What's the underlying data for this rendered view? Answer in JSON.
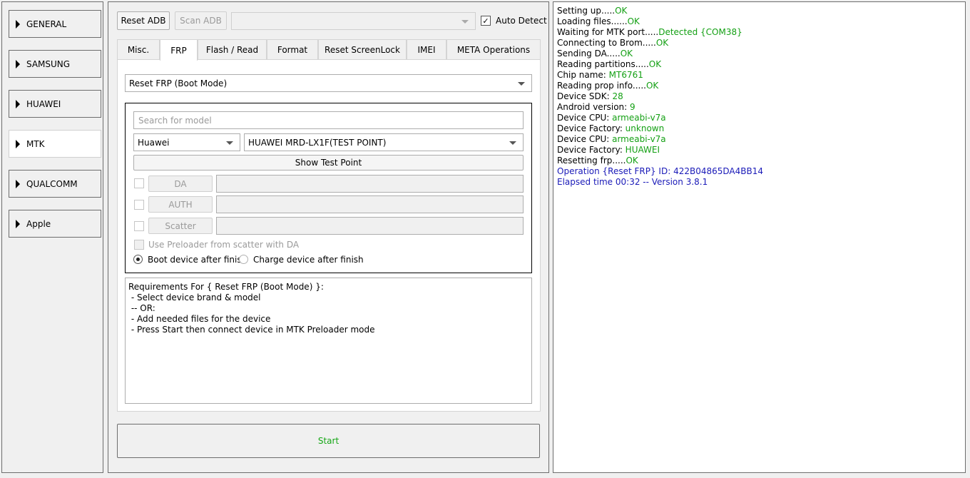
{
  "sidebar": {
    "items": [
      {
        "label": "GENERAL"
      },
      {
        "label": "SAMSUNG"
      },
      {
        "label": "HUAWEI"
      },
      {
        "label": "MTK"
      },
      {
        "label": "QUALCOMM"
      },
      {
        "label": "Apple"
      }
    ],
    "active": "MTK"
  },
  "toolbar": {
    "reset_adb": "Reset ADB",
    "scan_adb": "Scan ADB",
    "port_value": "",
    "auto_detect_label": "Auto Detect",
    "auto_detect_checked": "✓"
  },
  "tabs": [
    {
      "label": "Misc."
    },
    {
      "label": "FRP"
    },
    {
      "label": "Flash / Read"
    },
    {
      "label": "Format"
    },
    {
      "label": "Reset ScreenLock"
    },
    {
      "label": "IMEI"
    },
    {
      "label": "META Operations"
    }
  ],
  "frp": {
    "operation": "Reset FRP (Boot Mode)",
    "search_placeholder": "Search for model",
    "brand": "Huawei",
    "model": "HUAWEI MRD-LX1F(TEST POINT)",
    "show_test_point": "Show Test Point",
    "files": [
      {
        "label": "DA",
        "path": ""
      },
      {
        "label": "AUTH",
        "path": ""
      },
      {
        "label": "Scatter",
        "path": ""
      }
    ],
    "use_preloader": "Use Preloader from scatter with DA",
    "boot_after": "Boot device after finish",
    "charge_after": "Charge device after finish",
    "requirements": [
      "Requirements For { Reset FRP (Boot Mode) }:",
      " - Select device brand & model",
      " -- OR:",
      " - Add needed files for the device",
      " - Press Start then connect device in MTK Preloader mode"
    ]
  },
  "start_label": "Start",
  "log": [
    {
      "text": "Setting up.....",
      "value": "OK"
    },
    {
      "text": "Loading files......",
      "value": "OK"
    },
    {
      "text": "Waiting for MTK port.....",
      "value": "Detected {COM38}"
    },
    {
      "text": "Connecting to Brom.....",
      "value": "OK"
    },
    {
      "text": "Sending DA.....",
      "value": "OK"
    },
    {
      "text": "Reading partitions.....",
      "value": "OK"
    },
    {
      "text": "Chip name: ",
      "value": "MT6761"
    },
    {
      "text": "Reading prop info.....",
      "value": "OK"
    },
    {
      "text": "Device SDK: ",
      "value": "28"
    },
    {
      "text": "Android version: ",
      "value": "9"
    },
    {
      "text": "Device CPU: ",
      "value": "armeabi-v7a"
    },
    {
      "text": "Device Factory: ",
      "value": "unknown"
    },
    {
      "text": "Device CPU: ",
      "value": "armeabi-v7a"
    },
    {
      "text": "Device Factory: ",
      "value": "HUAWEI"
    },
    {
      "text": "Resetting frp.....",
      "value": "OK"
    },
    {
      "text": "Operation {Reset FRP} ID: 422B04865DA4BB14",
      "value": ""
    },
    {
      "text": "Elapsed time 00:32 -- Version 3.8.1",
      "value": ""
    }
  ],
  "colors": {
    "ok": "#14a014",
    "info": "#1a1ab8"
  }
}
